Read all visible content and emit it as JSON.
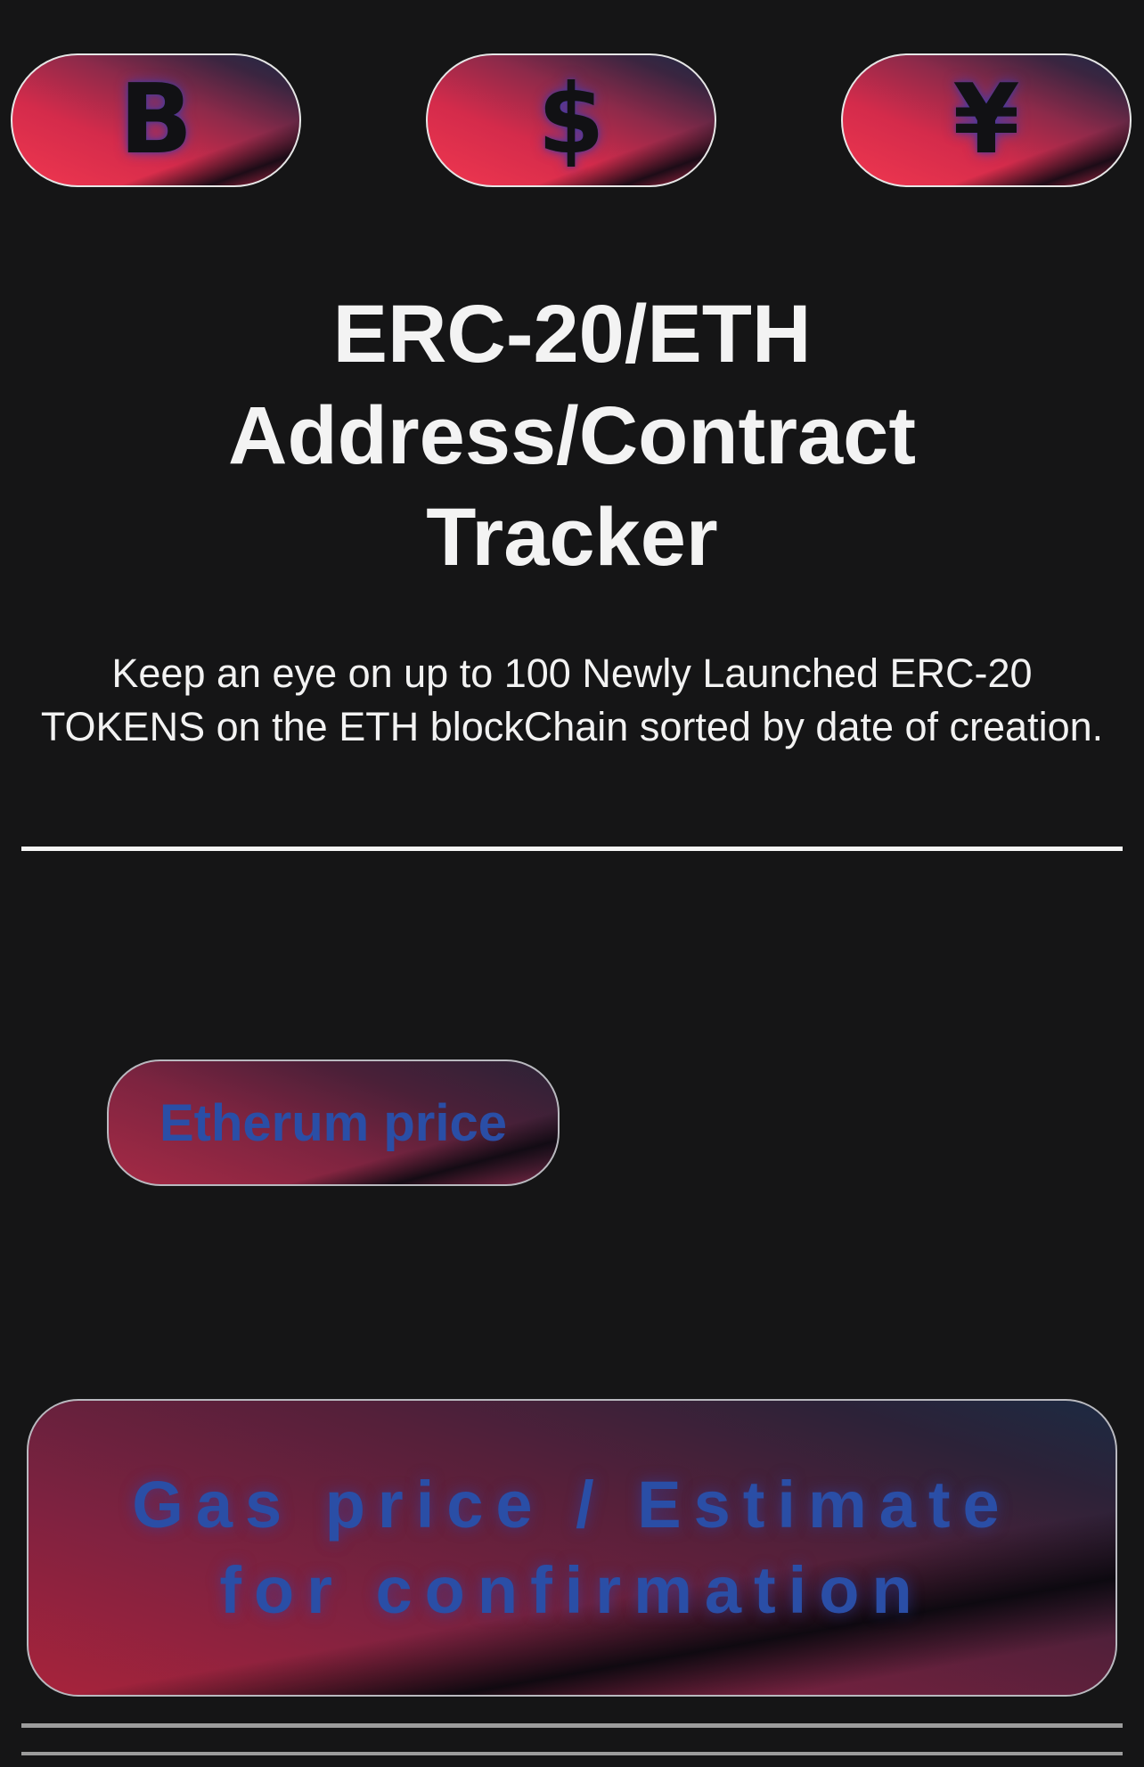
{
  "currency_buttons": [
    {
      "symbol": "B",
      "icon": "bitcoin-icon"
    },
    {
      "symbol": "$",
      "icon": "dollar-icon"
    },
    {
      "symbol": "¥",
      "icon": "yen-icon"
    }
  ],
  "header": {
    "title": "ERC-20/ETH\nAddress/Contract\nTracker",
    "subtitle": "Keep an eye on up to 100 Newly Launched ERC-20 TOKENS on the ETH blockChain sorted by date of creation."
  },
  "eth_price_button": {
    "label": "Etherum price"
  },
  "gas_panel": {
    "label": "Gas price / Estimate\nfor confirmation"
  },
  "colors": {
    "background": "#151516",
    "accent_red": "#f0374f",
    "label_blue": "#2a4ea6",
    "text": "#f2f2f2"
  }
}
